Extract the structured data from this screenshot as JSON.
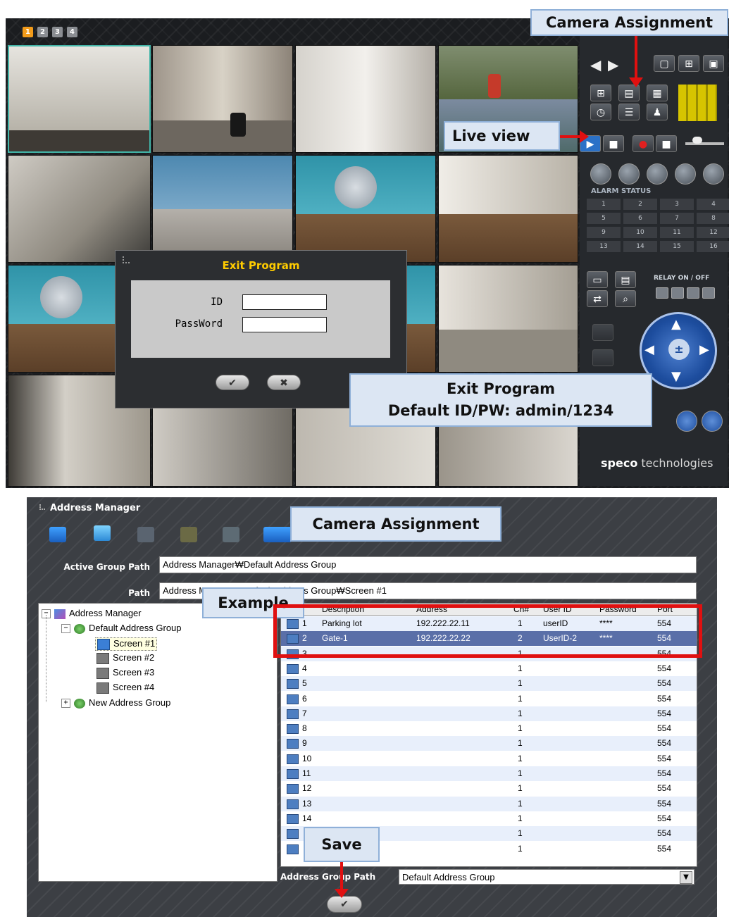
{
  "dvr": {
    "pages": [
      "1",
      "2",
      "3",
      "4"
    ],
    "alarm_status_label": "ALARM STATUS",
    "alarm_numbers": [
      "1",
      "2",
      "3",
      "4",
      "5",
      "6",
      "7",
      "8",
      "9",
      "10",
      "11",
      "12",
      "13",
      "14",
      "15",
      "16"
    ],
    "relay_label": "RELAY ON / OFF",
    "brand_bold": "speco",
    "brand_light": " technologies"
  },
  "exit_dialog": {
    "title": "Exit Program",
    "id_label": "ID",
    "password_label": "PassWord",
    "ok_icon": "check-icon",
    "cancel_icon": "close-icon"
  },
  "callouts": {
    "camera_assignment_top": "Camera Assignment",
    "live_view": "Live view",
    "exit_program_line1": "Exit Program",
    "exit_program_line2": "Default ID/PW: admin/1234",
    "camera_assignment_bottom": "Camera Assignment",
    "example": "Example",
    "save": "Save"
  },
  "address_manager": {
    "title": "Address Manager",
    "active_group_path_label": "Active Group Path",
    "active_group_path_value": "Address Manager₩Default Address Group",
    "path_label": "Path",
    "path_value": "Address Manager₩Default Address Group₩Screen #1",
    "tree": {
      "root": "Address Manager",
      "group1": "Default Address Group",
      "screens": [
        "Screen #1",
        "Screen #2",
        "Screen #3",
        "Screen #4"
      ],
      "group2": "New Address Group"
    },
    "grid": {
      "columns": [
        "",
        "Description",
        "Address",
        "Ch#",
        "User ID",
        "Password",
        "Port"
      ],
      "rows": [
        {
          "no": "1",
          "description": "Parking lot",
          "address": "192.222.22.11",
          "ch": "1",
          "user_id": "userID",
          "password": "****",
          "port": "554"
        },
        {
          "no": "2",
          "description": "Gate-1",
          "address": "192.222.22.22",
          "ch": "2",
          "user_id": "UserID-2",
          "password": "****",
          "port": "554"
        },
        {
          "no": "3",
          "description": "",
          "address": "",
          "ch": "1",
          "user_id": "",
          "password": "",
          "port": "554"
        },
        {
          "no": "4",
          "description": "",
          "address": "",
          "ch": "1",
          "user_id": "",
          "password": "",
          "port": "554"
        },
        {
          "no": "5",
          "description": "",
          "address": "",
          "ch": "1",
          "user_id": "",
          "password": "",
          "port": "554"
        },
        {
          "no": "6",
          "description": "",
          "address": "",
          "ch": "1",
          "user_id": "",
          "password": "",
          "port": "554"
        },
        {
          "no": "7",
          "description": "",
          "address": "",
          "ch": "1",
          "user_id": "",
          "password": "",
          "port": "554"
        },
        {
          "no": "8",
          "description": "",
          "address": "",
          "ch": "1",
          "user_id": "",
          "password": "",
          "port": "554"
        },
        {
          "no": "9",
          "description": "",
          "address": "",
          "ch": "1",
          "user_id": "",
          "password": "",
          "port": "554"
        },
        {
          "no": "10",
          "description": "",
          "address": "",
          "ch": "1",
          "user_id": "",
          "password": "",
          "port": "554"
        },
        {
          "no": "11",
          "description": "",
          "address": "",
          "ch": "1",
          "user_id": "",
          "password": "",
          "port": "554"
        },
        {
          "no": "12",
          "description": "",
          "address": "",
          "ch": "1",
          "user_id": "",
          "password": "",
          "port": "554"
        },
        {
          "no": "13",
          "description": "",
          "address": "",
          "ch": "1",
          "user_id": "",
          "password": "",
          "port": "554"
        },
        {
          "no": "14",
          "description": "",
          "address": "",
          "ch": "1",
          "user_id": "",
          "password": "",
          "port": "554"
        },
        {
          "no": "",
          "description": "",
          "address": "",
          "ch": "1",
          "user_id": "",
          "password": "",
          "port": "554"
        },
        {
          "no": "",
          "description": "",
          "address": "",
          "ch": "1",
          "user_id": "",
          "password": "",
          "port": "554"
        }
      ]
    },
    "address_group_path_label": "Address Group Path",
    "address_group_path_value": "Default Address Group"
  }
}
